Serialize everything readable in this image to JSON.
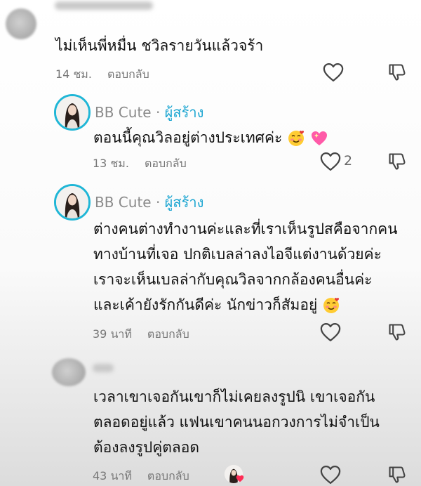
{
  "comments": [
    {
      "text": "ไม่เห็นพี่หมื่น ชวิลรายวันแล้วจร้า",
      "time": "14 ชม.",
      "reply": "ตอบกลับ"
    },
    {
      "author": "BB Cute",
      "author_dot": "·",
      "creator_label": "ผู้สร้าง",
      "text": "ตอนนี้คุณวิลอยู่ต่างประเทศค่ะ",
      "time": "13 ชม.",
      "reply": "ตอบกลับ",
      "likes": "2"
    },
    {
      "author": "BB Cute",
      "author_dot": "·",
      "creator_label": "ผู้สร้าง",
      "lines": [
        "ต่างคนต่างทำงานค่ะและที่เราเห็นรูปสคือจากคน",
        "ทางบ้านที่เจอ ปกติเบลล่าลงไอจีแต่งานด้วยค่ะ",
        "เราจะเห็นเบลล่ากับคุณวิลจากกล้องคนอื่นค่ะ",
        "และเค้ายังรักกันดีค่ะ นักข่าวก็สัมอยู่"
      ],
      "time": "39 นาที",
      "reply": "ตอบกลับ"
    },
    {
      "lines": [
        "เวลาเขาเจอกันเขาก็ไม่เคยลงรูปนิ เขาเจอกัน",
        "ตลอดอยู่แล้ว แฟนเขาคนนอกวงการไม่จำเป็น",
        "ต้องลงรูปคู่ตลอด"
      ],
      "time": "43 นาที",
      "reply": "ตอบกลับ"
    }
  ],
  "icons": {
    "like": "heart-outline-icon",
    "dislike": "thumbs-down-outline-icon",
    "emoji_smile": "smiling-face-with-hearts-emoji",
    "emoji_heart": "sparkling-heart-emoji"
  },
  "colors": {
    "creator": "#1aa5d1",
    "avatar_ring": "#20b6d6",
    "meta": "#777777"
  }
}
